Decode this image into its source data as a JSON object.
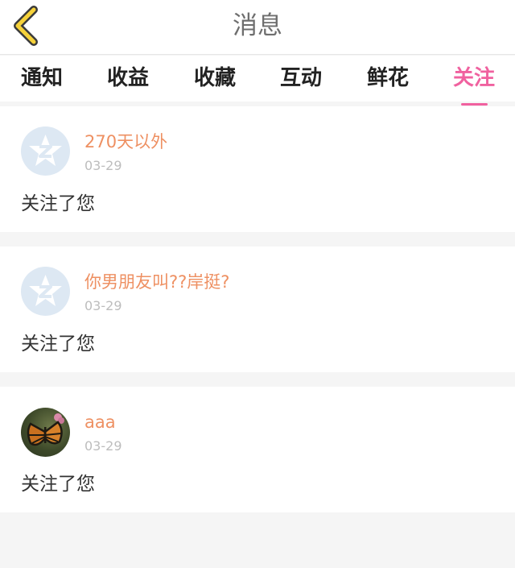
{
  "header": {
    "title": "消息"
  },
  "tabs": [
    {
      "label": "通知"
    },
    {
      "label": "收益"
    },
    {
      "label": "收藏"
    },
    {
      "label": "互动"
    },
    {
      "label": "鲜花"
    },
    {
      "label": "关注"
    }
  ],
  "active_tab": "关注",
  "colors": {
    "accent": "#f0619f",
    "username": "#ee9062",
    "date": "#bdbdbd"
  },
  "items": [
    {
      "user": "270天以外",
      "date": "03-29",
      "action": "关注了您",
      "avatar": "qq-default-avatar"
    },
    {
      "user": "你男朋友叫??岸挺?",
      "date": "03-29",
      "action": "关注了您",
      "avatar": "qq-default-avatar"
    },
    {
      "user": "aaa",
      "date": "03-29",
      "action": "关注了您",
      "avatar": "butterfly-photo-avatar"
    }
  ]
}
